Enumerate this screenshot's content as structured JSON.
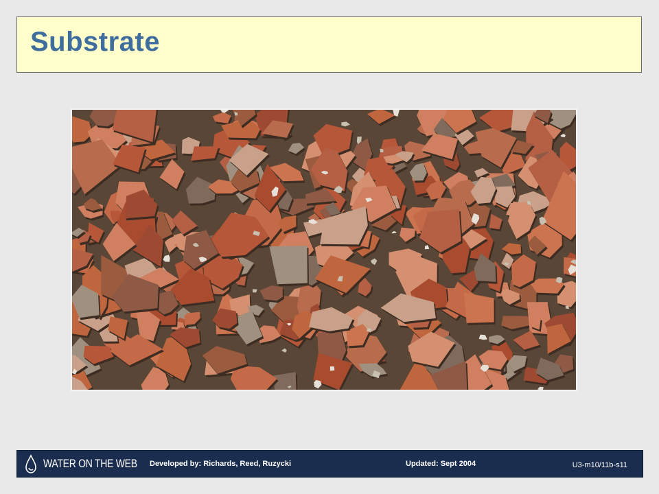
{
  "title": "Substrate",
  "photo": {
    "subject": "substrate-photo",
    "colors": {
      "base": "#5a4636",
      "brick": "#b35a33",
      "gray": "#8a8a8a"
    }
  },
  "footer": {
    "logo_text": "WATER ON THE WEB",
    "developed_by": "Developed  by:  Richards,  Reed,  Ruzycki",
    "updated": "Updated:  Sept 2004",
    "slide_code": "U3-m10/11b-s11",
    "background": "#1b2d4f"
  }
}
